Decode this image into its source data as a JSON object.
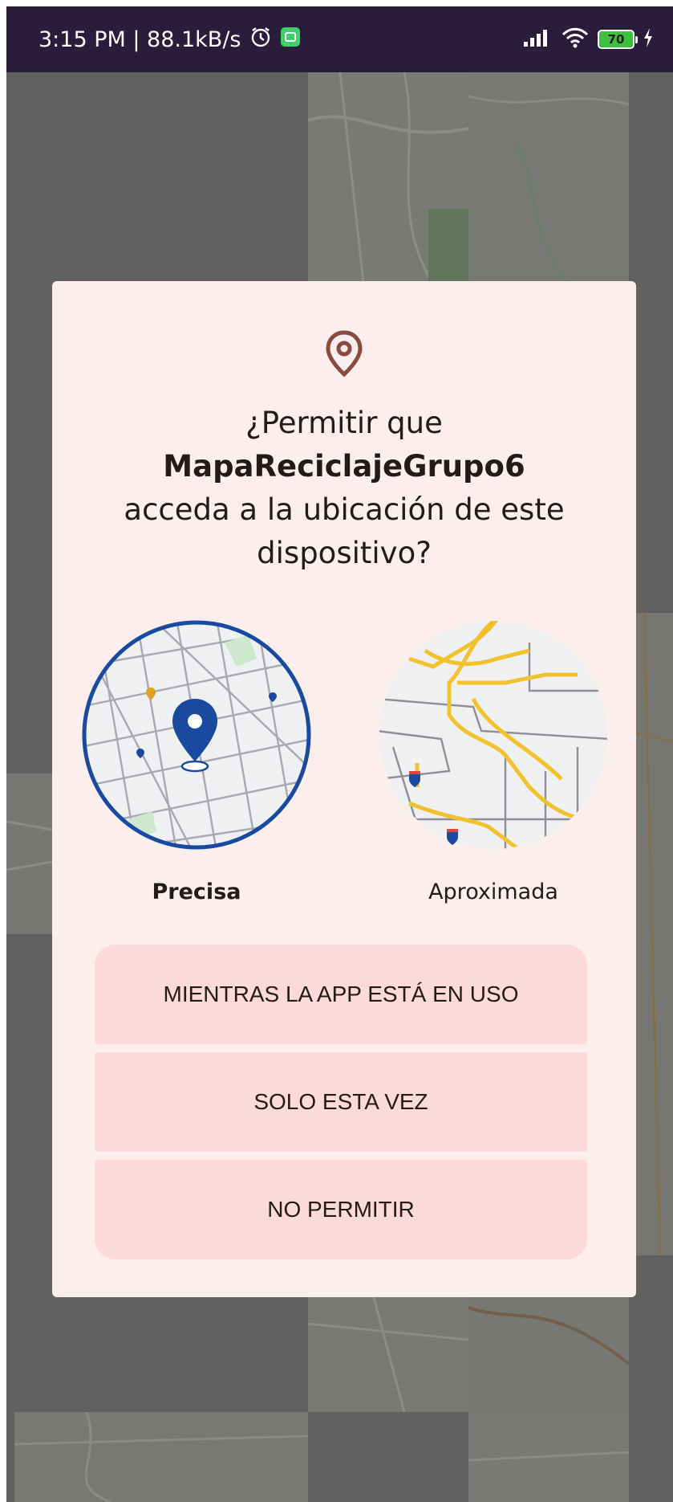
{
  "status_bar": {
    "time_and_speed": "3:15 PM | 88.1kB/s",
    "battery_level": "70",
    "icons": [
      "alarm-icon",
      "app-notification-icon",
      "signal-icon",
      "wifi-icon",
      "battery-icon",
      "charging-icon"
    ]
  },
  "dialog": {
    "icon": "location-pin-icon",
    "title_prefix": "¿Permitir que",
    "app_name": "MapaReciclajeGrupo6",
    "title_suffix": "acceda a la ubicación de este dispositivo?",
    "precise_label": "Precisa",
    "approximate_label": "Aproximada",
    "precise_selected": true,
    "buttons": {
      "while_using": "MIENTRAS LA APP ESTÁ EN USO",
      "only_this_time": "SOLO ESTA VEZ",
      "deny": "NO PERMITIR"
    }
  },
  "colors": {
    "status_bar": "#2a1c3b",
    "dialog_background": "#fbeeed",
    "button_background": "#fddada",
    "precise_accent": "#1a4aa0",
    "approximate_roads": "#f2c12e",
    "pin_icon": "#8a4a40"
  }
}
